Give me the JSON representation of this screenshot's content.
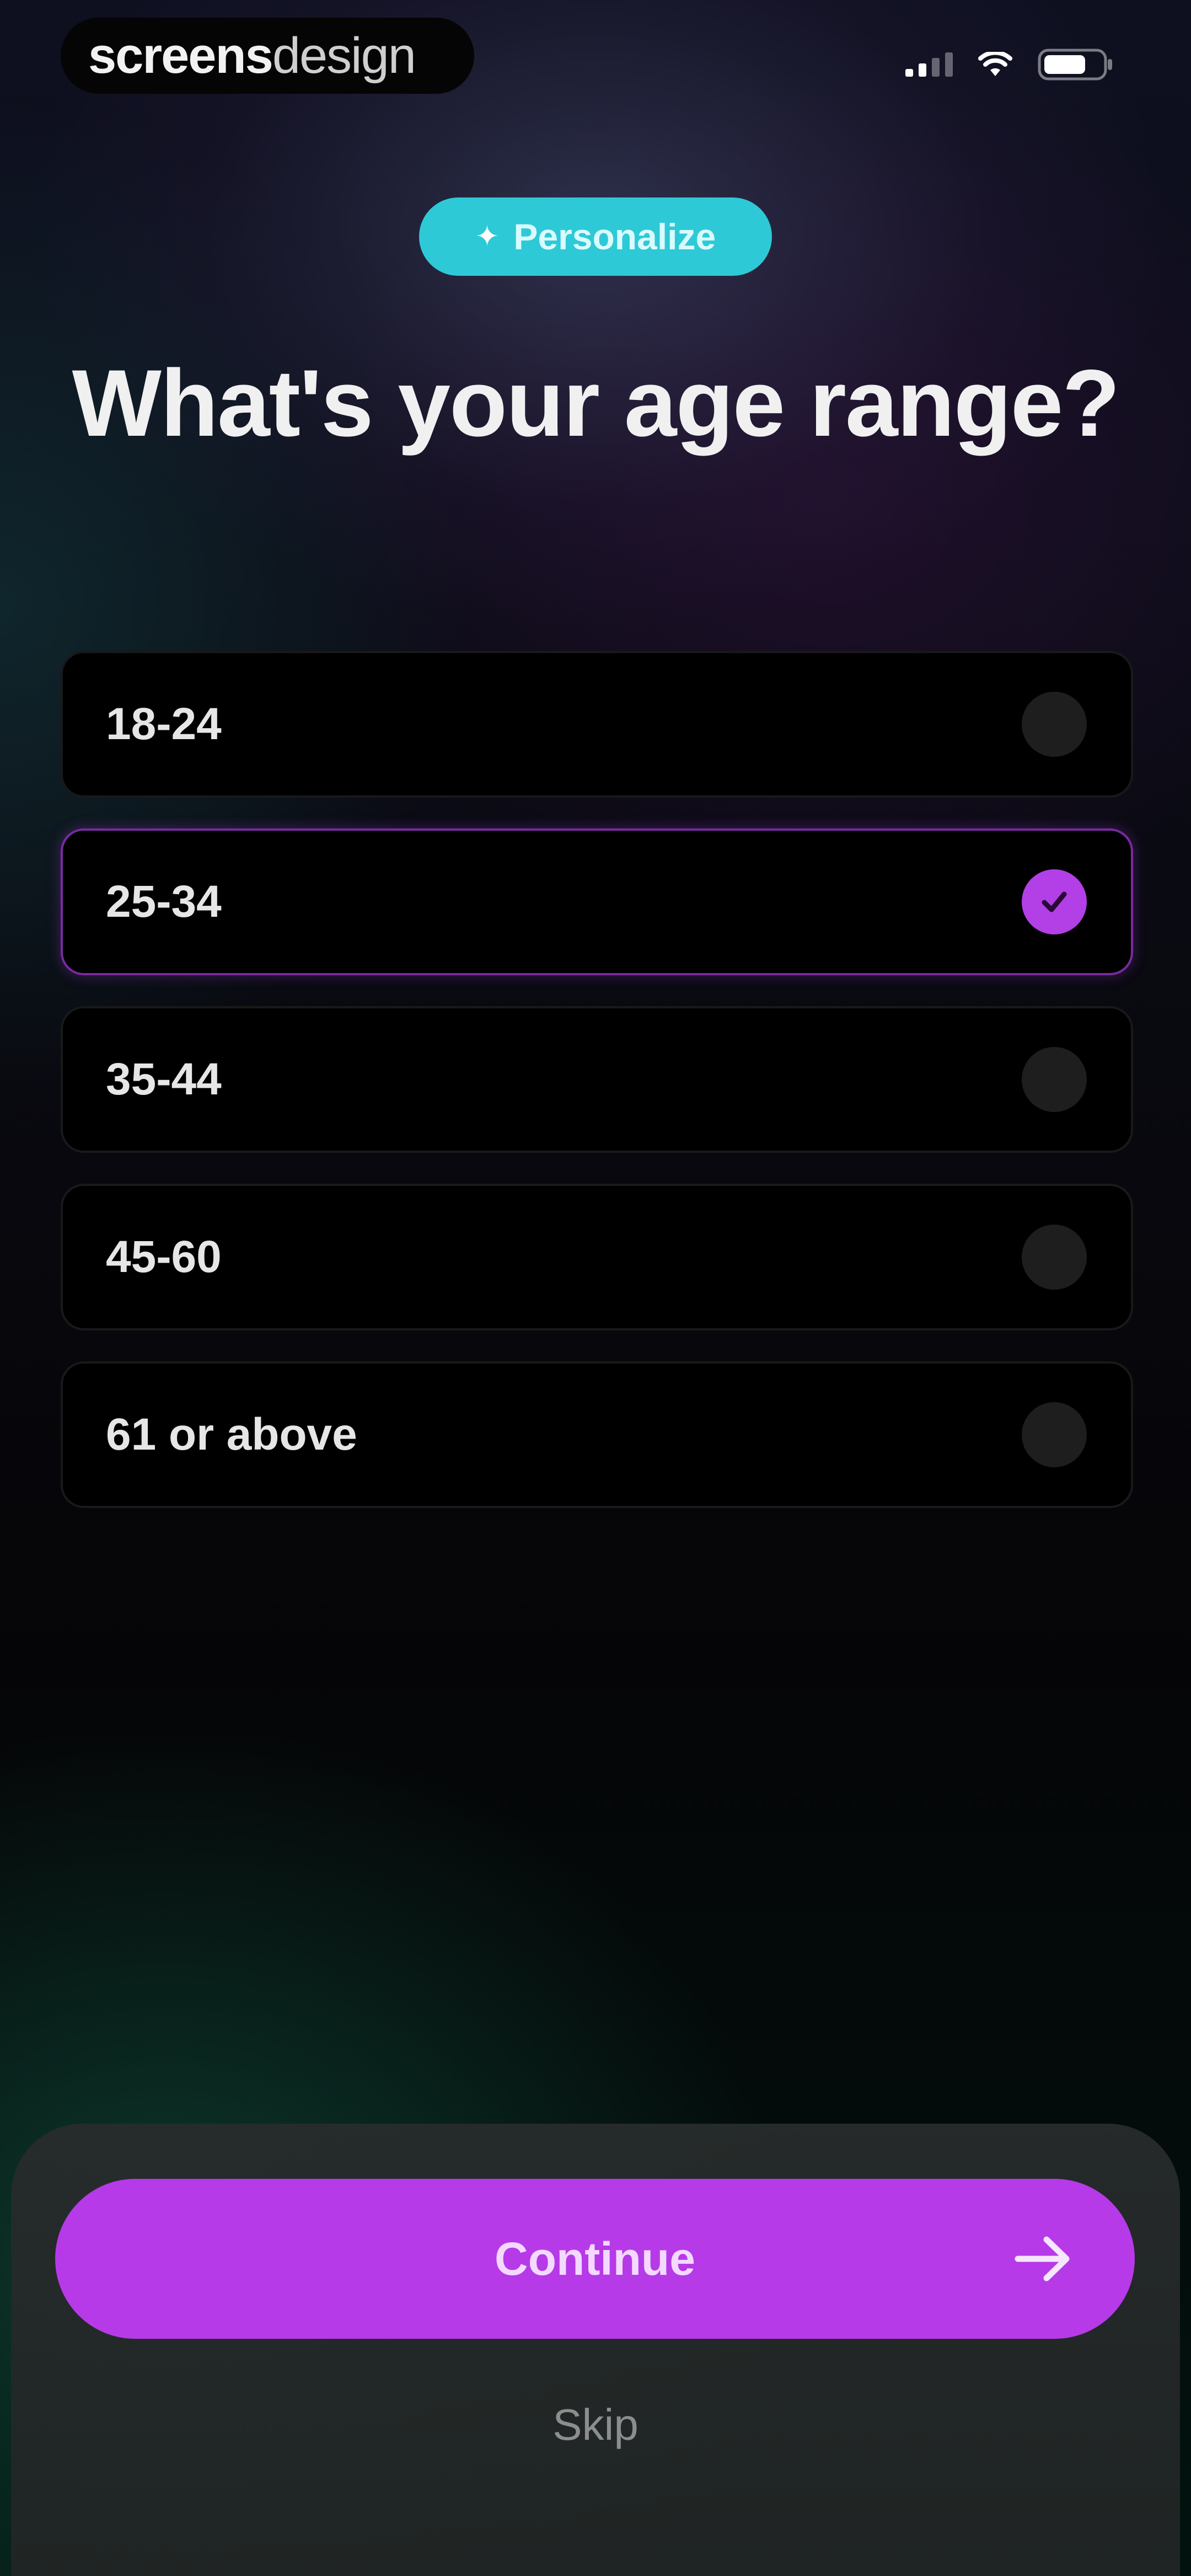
{
  "status_bar": {
    "brand_bold": "screens",
    "brand_light": "design"
  },
  "chip": {
    "label": "Personalize",
    "icon": "sparkle-icon"
  },
  "title": "What's your age range?",
  "options": [
    {
      "label": "18-24",
      "selected": false
    },
    {
      "label": "25-34",
      "selected": true
    },
    {
      "label": "35-44",
      "selected": false
    },
    {
      "label": "45-60",
      "selected": false
    },
    {
      "label": "61 or above",
      "selected": false
    }
  ],
  "actions": {
    "continue_label": "Continue",
    "continue_icon": "arrow-right-icon",
    "skip_label": "Skip"
  },
  "colors": {
    "accent": "#b63ae8",
    "chip": "#2ec9d6"
  }
}
